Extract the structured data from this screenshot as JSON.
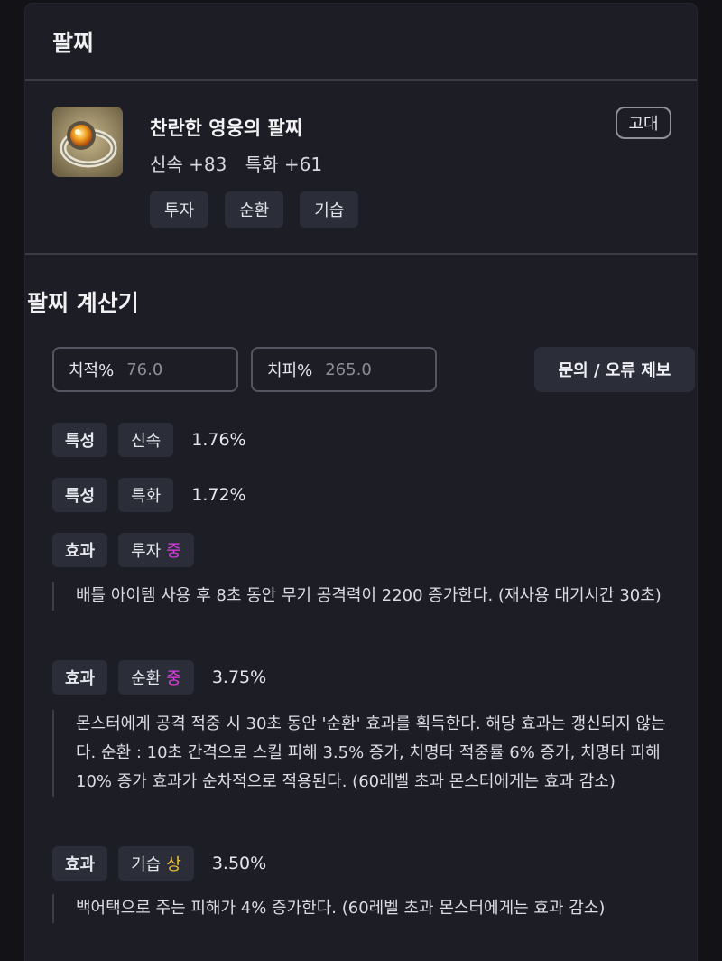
{
  "header": {
    "title": "팔찌"
  },
  "item": {
    "name": "찬란한 영웅의 팔찌",
    "grade": "고대",
    "stats": [
      "신속 +83",
      "특화 +61"
    ],
    "tags": [
      "투자",
      "순환",
      "기습"
    ],
    "icon": "bracelet-item-icon"
  },
  "calculator": {
    "title": "팔찌 계산기",
    "crit_rate": {
      "label": "치적%",
      "value": "76.0"
    },
    "crit_dmg": {
      "label": "치피%",
      "value": "265.0"
    },
    "report_label": "문의 / 오류 제보",
    "rows": [
      {
        "kind": "특성",
        "name": "신속",
        "grade": "",
        "pct": "1.76%"
      },
      {
        "kind": "특성",
        "name": "특화",
        "grade": "",
        "pct": "1.72%"
      },
      {
        "kind": "효과",
        "name": "투자",
        "grade": "중",
        "pct": "",
        "desc": "배틀 아이템 사용 후 8초 동안 무기 공격력이 2200 증가한다. (재사용 대기시간 30초)"
      },
      {
        "kind": "효과",
        "name": "순환",
        "grade": "중",
        "pct": "3.75%",
        "desc": "몬스터에게 공격 적중 시 30초 동안 '순환' 효과를 획득한다. 해당 효과는 갱신되지 않는다. 순환 : 10초 간격으로 스킬 피해 3.5% 증가, 치명타 적중률 6% 증가, 치명타 피해 10% 증가 효과가 순차적으로 적용된다. (60레벨 초과 몬스터에게는 효과 감소)"
      },
      {
        "kind": "효과",
        "name": "기습",
        "grade": "상",
        "pct": "3.50%",
        "desc": "백어택으로 주는 피해가 4% 증가한다. (60레벨 초과 몬스터에게는 효과 감소)"
      }
    ]
  },
  "colors": {
    "grade_mid": "#d83fe0",
    "grade_high": "#f2c230"
  }
}
